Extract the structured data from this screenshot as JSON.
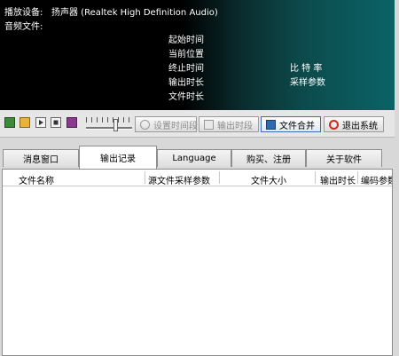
{
  "display": {
    "device_label": "播放设备:",
    "device_value": "扬声器 (Realtek High Definition Audio)",
    "audio_file_label": "音频文件:",
    "labels": [
      "起始时间",
      "当前位置",
      "终止时间",
      "输出时长",
      "文件时长"
    ],
    "right_labels": [
      "比 特 率",
      "采样参数"
    ]
  },
  "toolbar": {
    "icons": [
      "save-icon",
      "folder-open-icon",
      "play-icon",
      "stop-icon",
      "book-icon"
    ],
    "slider_value": 0.65,
    "set_period_label": "设置时间段",
    "output_period_label": "输出时段",
    "merge_label": "文件合并",
    "exit_label": "退出系统"
  },
  "tabs": [
    {
      "label": "消息窗口",
      "selected": false
    },
    {
      "label": "输出记录",
      "selected": true
    },
    {
      "label": "Language",
      "selected": false
    },
    {
      "label": "购买、注册",
      "selected": false
    },
    {
      "label": "关于软件",
      "selected": false
    }
  ],
  "table": {
    "columns": [
      "文件名称",
      "源文件采样参数",
      "文件大小",
      "输出时长",
      "编码参数"
    ]
  },
  "colors": {
    "display_bg_start": "#000000",
    "display_bg_end": "#0a6366",
    "merge_border": "#3a6fb5",
    "exit_icon": "#cc2a1a"
  }
}
